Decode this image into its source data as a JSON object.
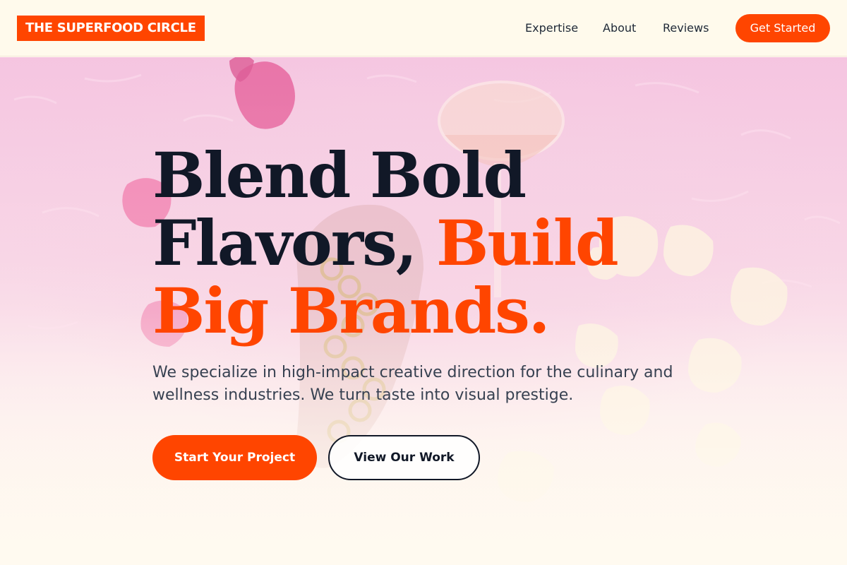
{
  "header": {
    "logo": "THE SUPERFOOD CIRCLE",
    "nav": [
      {
        "label": "Expertise"
      },
      {
        "label": "About"
      },
      {
        "label": "Reviews"
      }
    ],
    "cta_label": "Get Started"
  },
  "hero": {
    "headline_part1": "Blend Bold Flavors, ",
    "headline_accent": "Build Big Brands.",
    "subtext": "We specialize in high-impact creative direction for the culinary and wellness industries. We turn taste into visual prestige.",
    "primary_button": "Start Your Project",
    "secondary_button": "View Our Work"
  },
  "colors": {
    "accent": "#ff4500",
    "ink": "#111827",
    "background": "#fffaf0",
    "hero_pink": "#f3b9dd"
  },
  "background_image": {
    "description_icon": "rose-petals-cocktail-photo"
  }
}
